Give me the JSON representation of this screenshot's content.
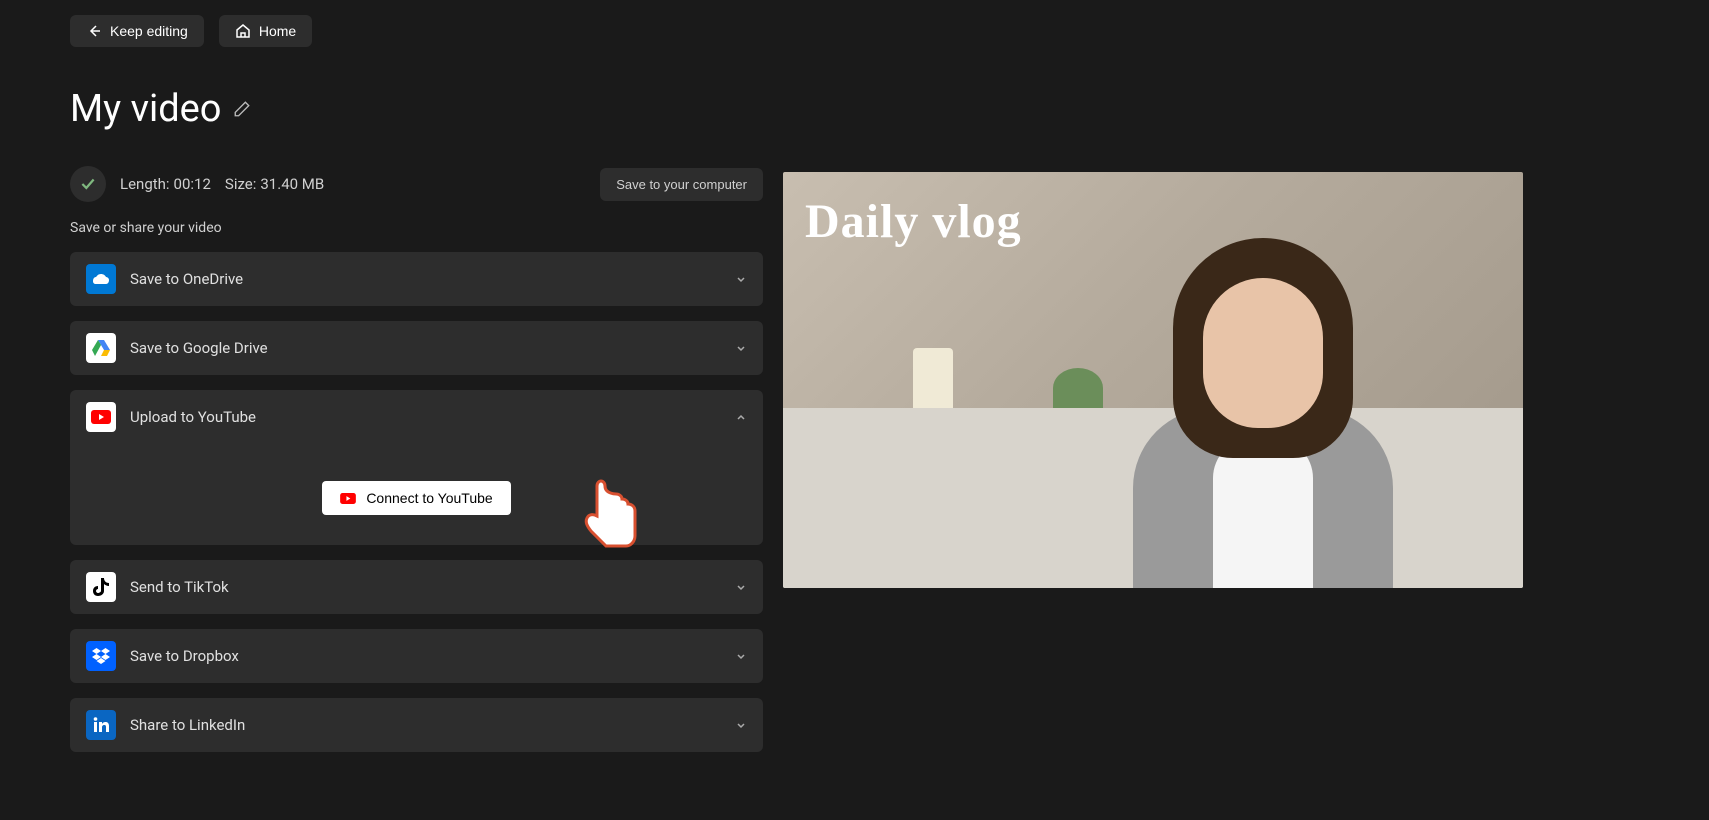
{
  "nav": {
    "keep_editing": "Keep editing",
    "home": "Home"
  },
  "title": "My video",
  "info": {
    "length_label": "Length:",
    "length_value": "00:12",
    "size_label": "Size:",
    "size_value": "31.40 MB"
  },
  "save_computer": "Save to your computer",
  "save_share_label": "Save or share your video",
  "share_options": {
    "onedrive": "Save to OneDrive",
    "gdrive": "Save to Google Drive",
    "youtube": "Upload to YouTube",
    "tiktok": "Send to TikTok",
    "dropbox": "Save to Dropbox",
    "linkedin": "Share to LinkedIn"
  },
  "connect_youtube": "Connect to YouTube",
  "preview_title": "Daily vlog"
}
